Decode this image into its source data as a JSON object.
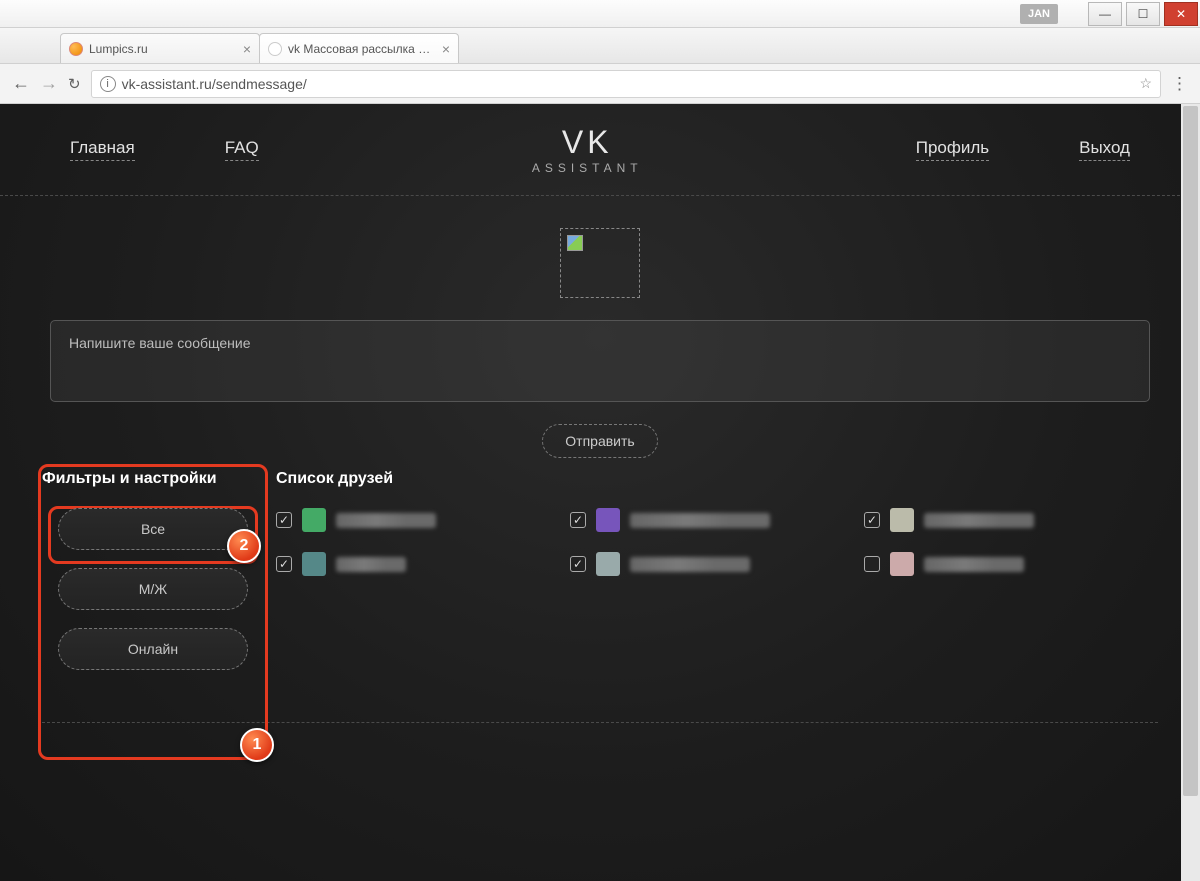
{
  "os": {
    "badge": "JAN",
    "min": "—",
    "max": "☐",
    "close": "✕"
  },
  "tabs": [
    {
      "title": "Lumpics.ru",
      "favicon": "orange"
    },
    {
      "title": "vk  Массовая рассылка соо...",
      "favicon": "blank"
    }
  ],
  "tab_close_glyph": "×",
  "address": {
    "url": "vk-assistant.ru/sendmessage/",
    "info_glyph": "i",
    "star": "☆",
    "back": "←",
    "fwd": "→",
    "reload": "↻",
    "menu": "⋮"
  },
  "nav": {
    "left": [
      "Главная",
      "FAQ"
    ],
    "right": [
      "Профиль",
      "Выход"
    ],
    "logo_top": "VK",
    "logo_sub": "ASSISTANT"
  },
  "message": {
    "placeholder": "Напишите ваше сообщение",
    "send_label": "Отправить"
  },
  "filters": {
    "title": "Фильтры и настройки",
    "buttons": [
      "Все",
      "М/Ж",
      "Онлайн"
    ]
  },
  "friends": {
    "title": "Список друзей",
    "items": [
      {
        "checked": true,
        "avatar": "#4a6",
        "name_w": 100
      },
      {
        "checked": true,
        "avatar": "#75b",
        "name_w": 140
      },
      {
        "checked": true,
        "avatar": "#bba",
        "name_w": 110
      },
      {
        "checked": true,
        "avatar": "#588",
        "name_w": 70
      },
      {
        "checked": true,
        "avatar": "#9aa",
        "name_w": 120
      },
      {
        "checked": false,
        "avatar": "#caa",
        "name_w": 100
      }
    ]
  },
  "callouts": {
    "outer": "1",
    "inner": "2"
  }
}
